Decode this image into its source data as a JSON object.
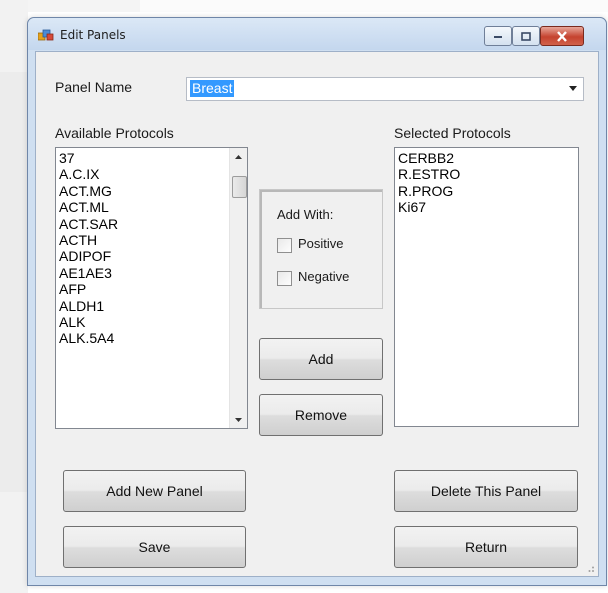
{
  "window": {
    "title": "Edit Panels"
  },
  "panel_name": {
    "label": "Panel Name",
    "value": "Breast"
  },
  "available_protocols": {
    "label": "Available Protocols",
    "items": [
      "37",
      "A.C.IX",
      "ACT.MG",
      "ACT.ML",
      "ACT.SAR",
      "ACTH",
      "ADIPOF",
      "AE1AE3",
      "AFP",
      "ALDH1",
      "ALK",
      "ALK.5A4"
    ]
  },
  "selected_protocols": {
    "label": "Selected Protocols",
    "items": [
      "CERBB2",
      "R.ESTRO",
      "R.PROG",
      "Ki67"
    ]
  },
  "add_with": {
    "label": "Add With:",
    "positive_label": "Positive",
    "negative_label": "Negative"
  },
  "buttons": {
    "add": "Add",
    "remove": "Remove",
    "add_new_panel": "Add New Panel",
    "delete_this_panel": "Delete This Panel",
    "save": "Save",
    "return": "Return"
  },
  "colors": {
    "selection": "#3399ff",
    "close_button": "#c5432f",
    "window_frame": "#cfdff1"
  }
}
